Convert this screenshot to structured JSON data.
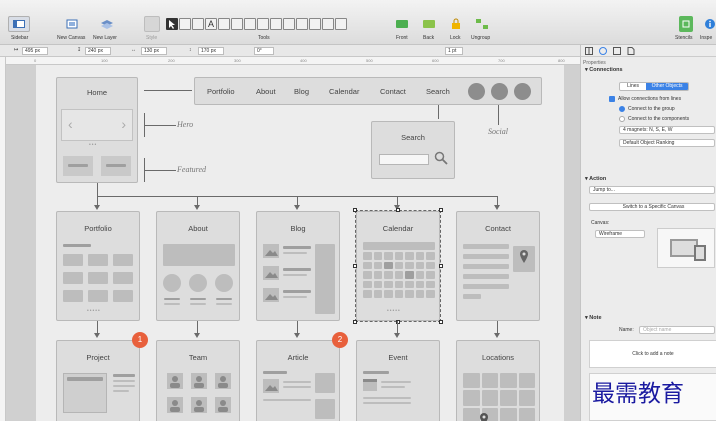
{
  "toolbar": {
    "sidebar": "Sidebar",
    "new_canvas": "New Canvas",
    "new_layer": "New Layer",
    "style": "Style",
    "tools": "Tools",
    "front": "Front",
    "back": "Back",
    "lock": "Lock",
    "ungroup": "Ungroup",
    "stencils": "Stencils",
    "inspect": "Inspe"
  },
  "geometry_bar": {
    "x": "495 px",
    "y": "240 px",
    "w": "130 px",
    "h": "170 px",
    "angle": "0°",
    "stroke": "1 pt"
  },
  "ruler_marks": [
    "0",
    "100",
    "200",
    "300",
    "400",
    "500",
    "600",
    "700",
    "800",
    "900",
    "1000"
  ],
  "wireframe": {
    "home": "Home",
    "hero": "Hero",
    "featured": "Featured",
    "nav": [
      "Portfolio",
      "About",
      "Blog",
      "Calendar",
      "Contact",
      "Search"
    ],
    "search_box": "Search",
    "social": "Social",
    "level1": [
      "Portfolio",
      "About",
      "Blog",
      "Calendar",
      "Contact"
    ],
    "level2": [
      "Project",
      "Team",
      "Article",
      "Event",
      "Locations"
    ],
    "badges": [
      "1",
      "2"
    ]
  },
  "inspector": {
    "properties": "Properties",
    "connections": "Connections",
    "tab_lines": "Lines",
    "tab_other": "Other Objects",
    "allow_connections": "Allow connections from lines",
    "connect_group": "Connect to the group",
    "connect_components": "Connect to the components",
    "magnets": "4 magnets: N, S, E, W",
    "ranking": "Default Object Ranking",
    "action": "Action",
    "jump_to": "Jump to...",
    "switch_canvas": "Switch to a Specific Canvas",
    "canvas_label": "Canvas:",
    "canvas_value": "Wireframe",
    "note": "Note",
    "name_label": "Name:",
    "name_placeholder": "Object name",
    "add_note": "Click to add a note",
    "data_label": "Da"
  },
  "watermark": "最需教育"
}
